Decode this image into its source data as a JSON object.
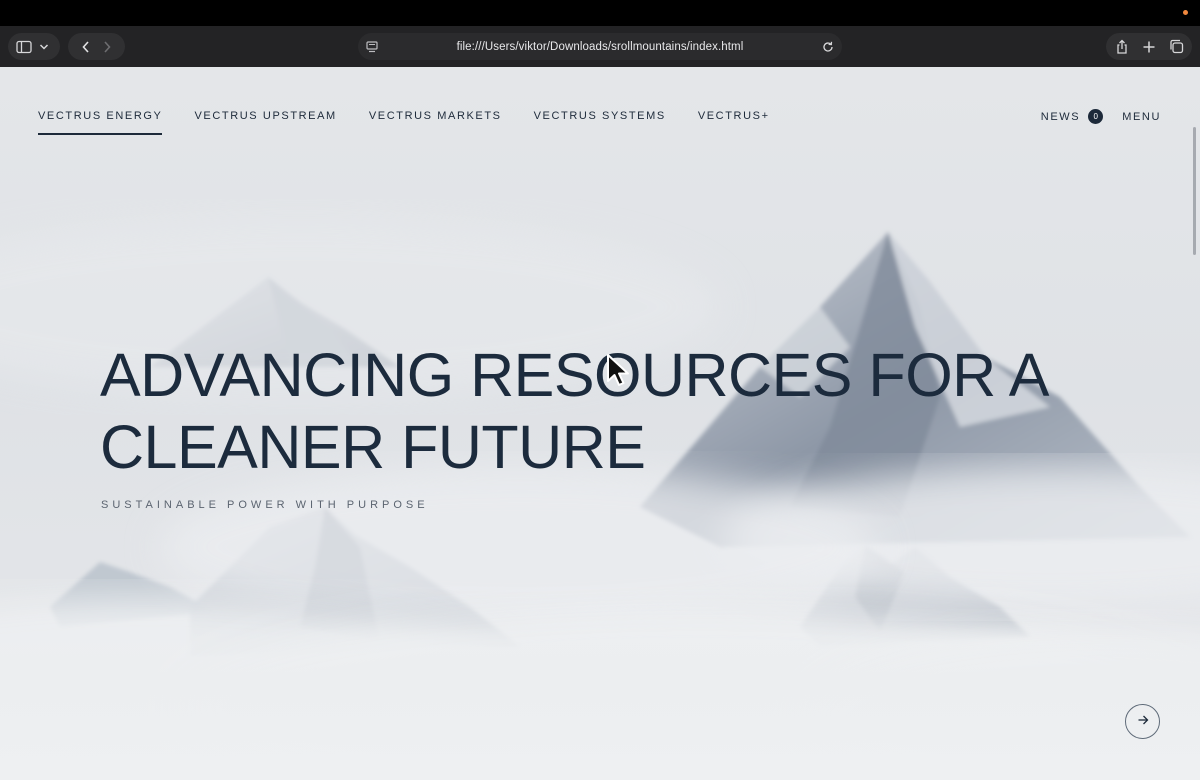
{
  "browser": {
    "url": "file:///Users/viktor/Downloads/srollmountains/index.html",
    "icons": [
      "sidebar-icon",
      "chevron-down-icon",
      "back-icon",
      "forward-icon",
      "page-icon",
      "reload-icon",
      "share-icon",
      "plus-icon",
      "tabs-icon"
    ]
  },
  "nav": {
    "items": [
      {
        "label": "VECTRUS ENERGY",
        "active": true
      },
      {
        "label": "VECTRUS UPSTREAM",
        "active": false
      },
      {
        "label": "VECTRUS MARKETS",
        "active": false
      },
      {
        "label": "VECTRUS SYSTEMS",
        "active": false
      },
      {
        "label": "VECTRUS+",
        "active": false
      }
    ],
    "news_label": "NEWS",
    "news_count": "0",
    "menu_label": "MENU"
  },
  "hero": {
    "title": "ADVANCING RESOURCES FOR A CLEANER FUTURE",
    "subtitle": "SUSTAINABLE POWER WITH PURPOSE",
    "next_icon": "arrow-right-icon"
  },
  "colors": {
    "ink": "#1c2b3d",
    "fog": "#e9eaec",
    "toolbar": "#232325",
    "notification_dot": "#f0883e"
  }
}
